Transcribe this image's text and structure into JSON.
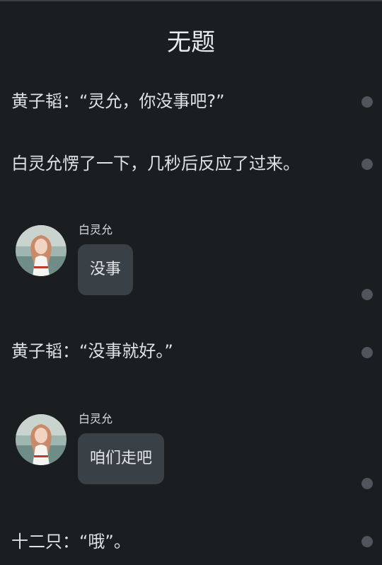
{
  "title": "无题",
  "lines": [
    "黄子韬：“灵允，你没事吧?”",
    "白灵允愣了一下，几秒后反应了过来。",
    "黄子韬：“没事就好。”",
    "十二只：“哦”。"
  ],
  "chats": [
    {
      "speaker": "白灵允",
      "text": "没事"
    },
    {
      "speaker": "白灵允",
      "text": "咱们走吧"
    }
  ],
  "avatar_icon": "profile-photo-icon",
  "colors": {
    "background": "#1b1e21",
    "text": "#dfe2e4",
    "bubble": "#3a4146",
    "dot": "#4f555b"
  }
}
